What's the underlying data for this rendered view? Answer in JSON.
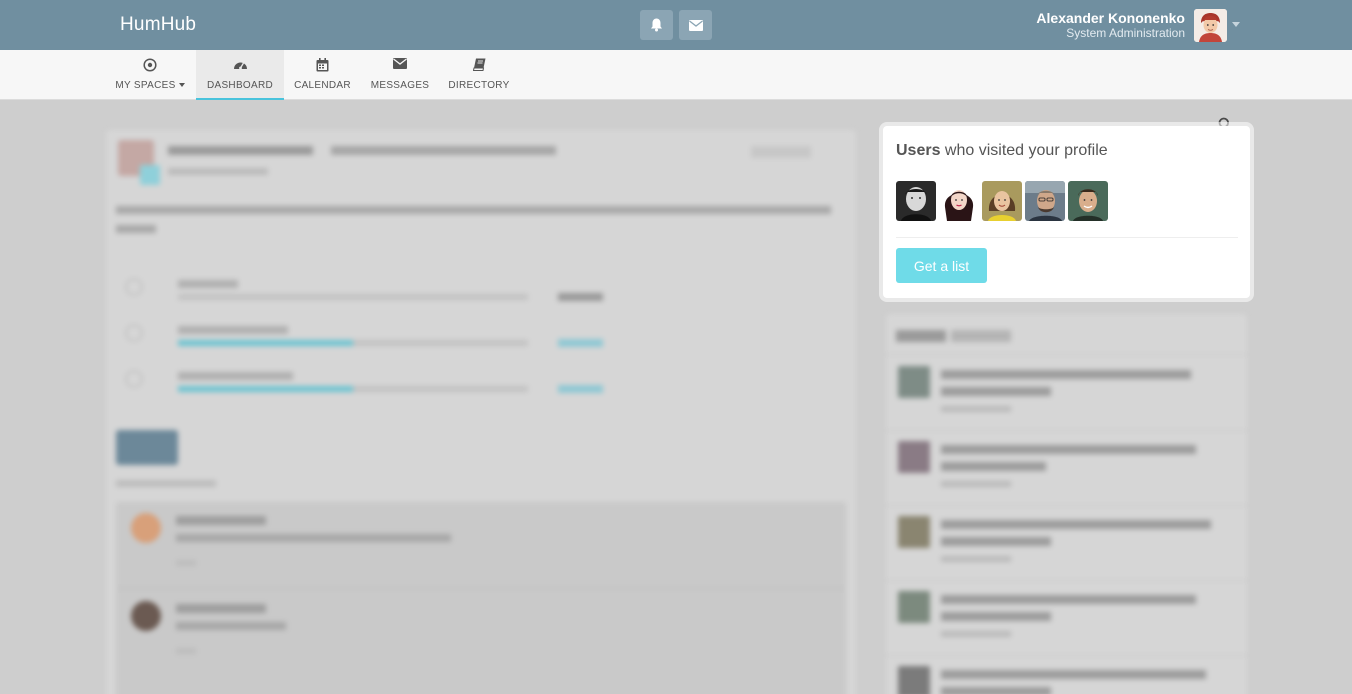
{
  "app": {
    "brand": "HumHub"
  },
  "header": {
    "user_name": "Alexander Kononenko",
    "user_role": "System Administration",
    "icons": [
      "bell-icon",
      "envelope-icon"
    ]
  },
  "nav": {
    "items": [
      {
        "label": "MY SPACES",
        "icon": "dot-circle-icon"
      },
      {
        "label": "DASHBOARD",
        "icon": "dashboard-icon"
      },
      {
        "label": "CALENDAR",
        "icon": "calendar-icon"
      },
      {
        "label": "MESSAGES",
        "icon": "envelope-icon"
      },
      {
        "label": "DIRECTORY",
        "icon": "book-icon"
      }
    ],
    "active": "DASHBOARD"
  },
  "users_panel": {
    "title_bold": "Users",
    "title_rest": " who visited your profile",
    "visitors": [
      "visitor-1",
      "visitor-2",
      "visitor-3",
      "visitor-4",
      "visitor-5"
    ],
    "button": "Get a list"
  },
  "colors": {
    "topbar": "#708fa0",
    "accent": "#6fdbe8",
    "active_underline": "#49c3dc"
  }
}
